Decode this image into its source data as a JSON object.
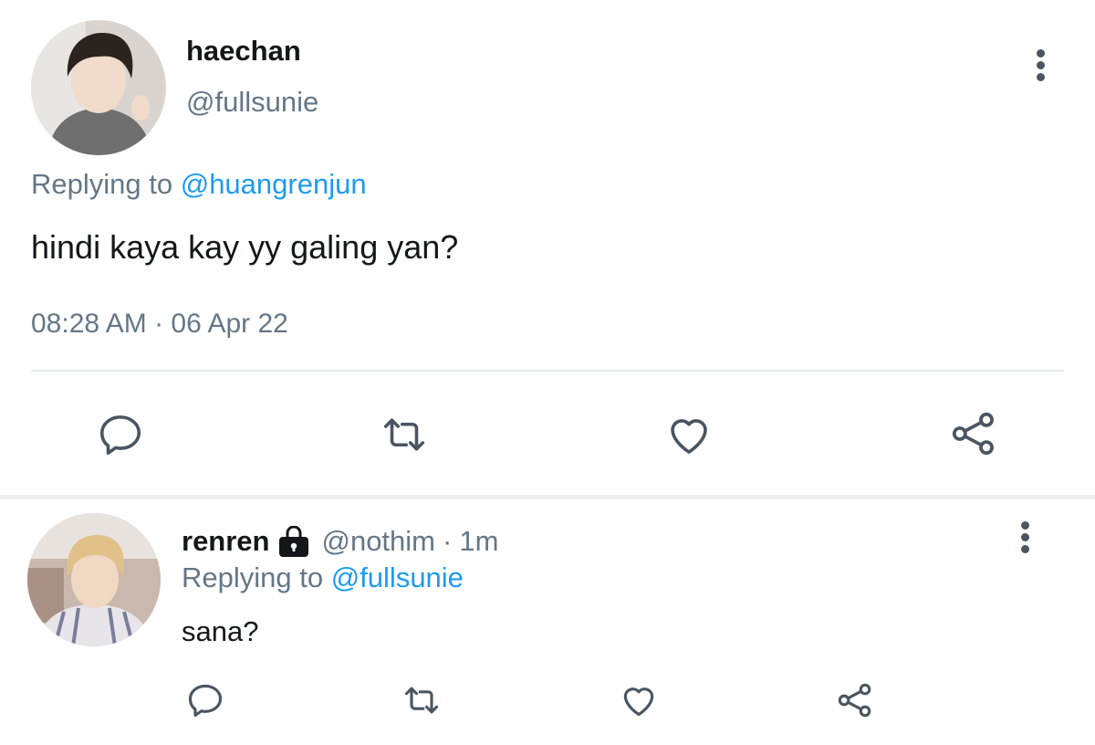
{
  "main_tweet": {
    "name": "haechan",
    "handle": "@fullsunie",
    "replying_prefix": "Replying to",
    "replying_to": "@huangrenjun",
    "text": "hindi kaya kay yy galing yan?",
    "timestamp": "08:28 AM · 06 Apr 22"
  },
  "reply_tweet": {
    "name": "renren",
    "handle": "@nothim",
    "dot": "·",
    "time": "1m",
    "replying_prefix": "Replying to",
    "replying_to": "@fullsunie",
    "text": "sana?"
  },
  "actions": [
    "comment-icon",
    "retweet-icon",
    "heart-icon",
    "share-icon"
  ],
  "colors": {
    "mention": "#1d9bf0",
    "secondary_text": "#657786",
    "icon": "#4a5561"
  }
}
